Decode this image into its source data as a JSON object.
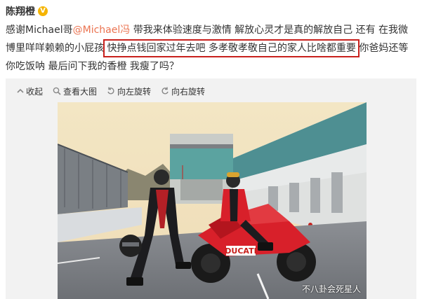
{
  "header": {
    "username": "陈翔橙",
    "verified_badge": "V"
  },
  "post": {
    "text_1": "感谢Michael哥",
    "mention": "@Michael冯",
    "text_2": " 带我来体验速度与激情 解放心灵才是真的解放自己 还有 在我微博里咩咩赖赖的小屁孩 ",
    "highlighted": "快挣点钱回家过年去吧 多孝敬孝敬自己的家人比啥都重要",
    "text_3": " 你爸妈还等你吃饭呐 最后问下我的香橙 我瘦了吗？"
  },
  "toolbar": {
    "collapse": "收起",
    "view_large": "查看大图",
    "rotate_left": "向左旋转",
    "rotate_right": "向右旋转"
  },
  "photo": {
    "bike_brand": "DUCATI",
    "watermark": "不八卦会死星人"
  },
  "colors": {
    "mention": "#eb7350",
    "highlight_border": "#c8201c",
    "badge": "#f5b400",
    "bike_red": "#d8202a"
  },
  "icons": [
    "collapse-icon",
    "magnifier-icon",
    "rotate-left-icon",
    "rotate-right-icon"
  ]
}
